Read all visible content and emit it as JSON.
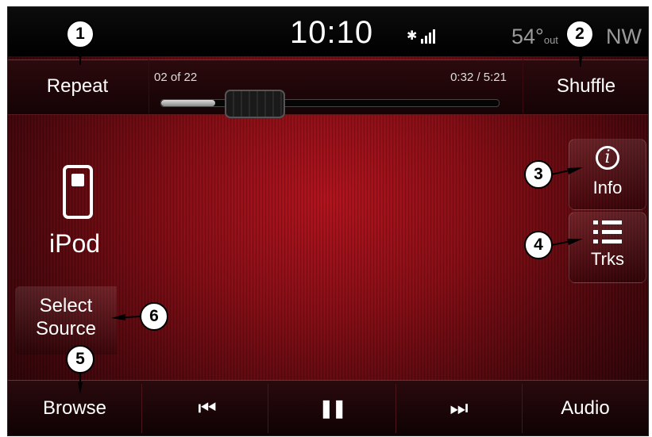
{
  "status": {
    "clock": "10:10",
    "temperature": "54°",
    "temperature_unit": "out",
    "compass": "NW"
  },
  "header": {
    "repeat_label": "Repeat",
    "shuffle_label": "Shuffle",
    "track_count": "02 of 22",
    "track_time": "0:32 / 5:21",
    "progress_fraction": 0.16
  },
  "source": {
    "name": "iPod",
    "select_source_line1": "Select",
    "select_source_line2": "Source"
  },
  "side_buttons": {
    "info_label": "Info",
    "tracks_label": "Trks"
  },
  "bottom": {
    "browse_label": "Browse",
    "audio_label": "Audio",
    "prev_glyph": "⏮",
    "pause_glyph": "❚❚",
    "next_glyph": "⏭"
  },
  "callouts": [
    "1",
    "2",
    "3",
    "4",
    "5",
    "6"
  ]
}
